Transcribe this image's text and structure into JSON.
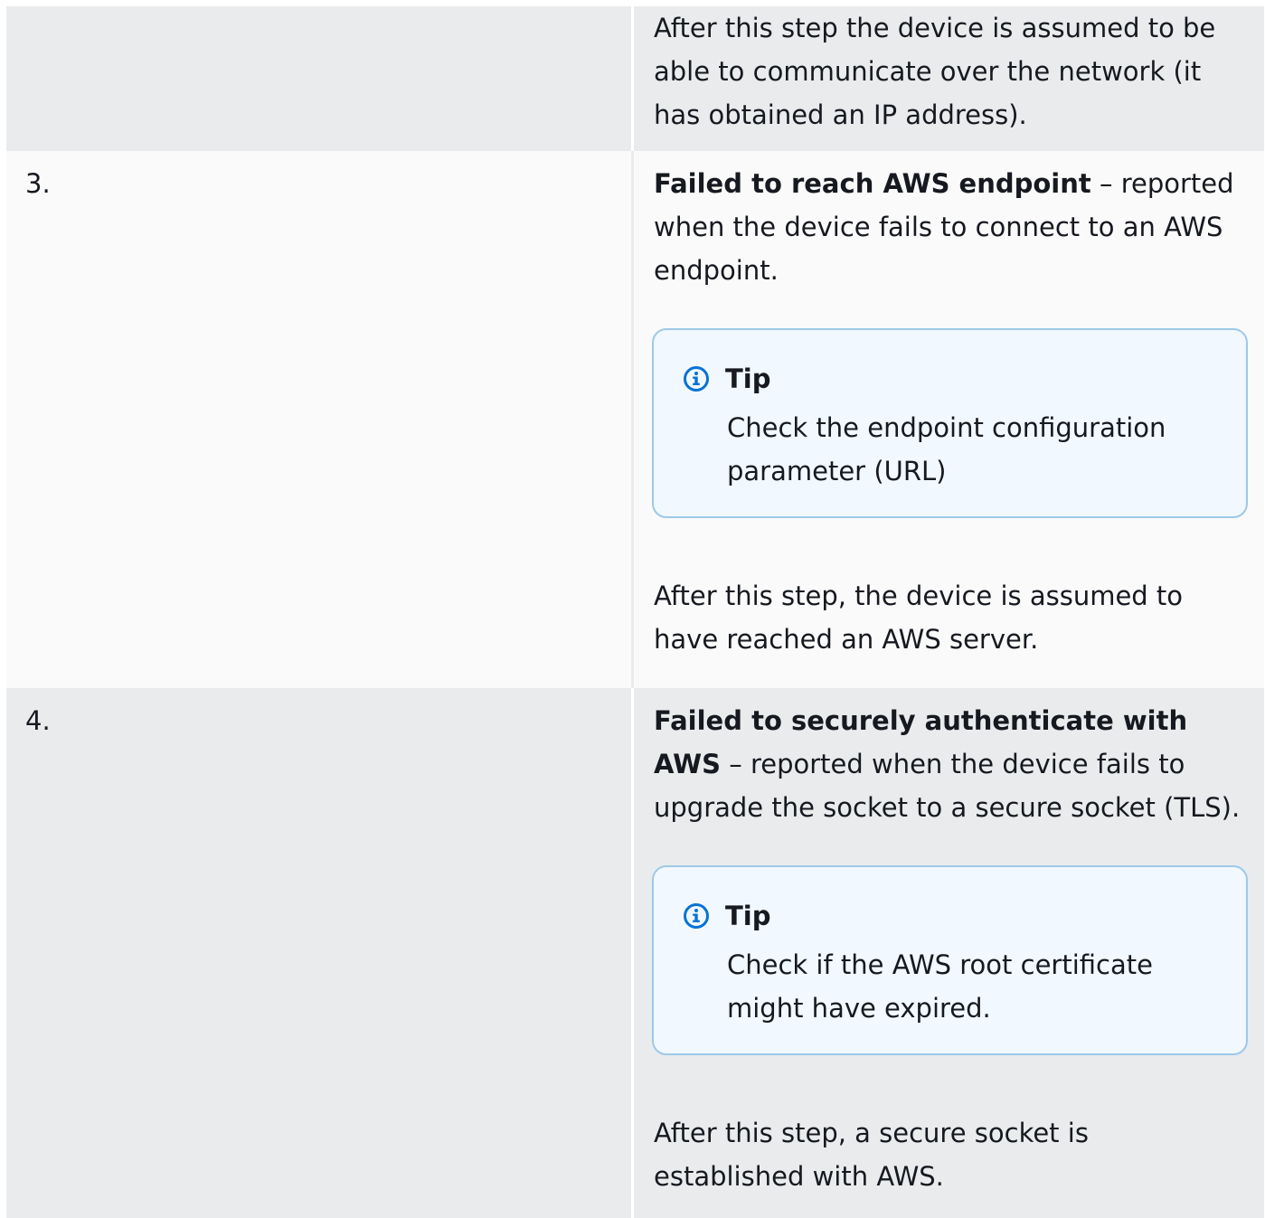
{
  "colors": {
    "row_gray": "#e9ebed",
    "row_white": "#fafafa",
    "tip_background": "#f1f8ff",
    "tip_border": "#9ec9e8",
    "icon_blue": "#0972d3"
  },
  "rows": [
    {
      "number": "",
      "after_text": "After this step the device is assumed to be able to communicate over the network (it has obtained an IP address)."
    },
    {
      "number": "3.",
      "title": "Failed to reach AWS endpoint",
      "description": " – reported when the device fails to connect to an AWS endpoint.",
      "tip_label": "Tip",
      "tip_icon": "info-icon",
      "tip_text": "Check the endpoint configuration parameter (URL)",
      "after_text": "After this step, the device is assumed to have reached an AWS server."
    },
    {
      "number": "4.",
      "title": "Failed to securely authenticate with AWS",
      "description": " – reported when the device fails to upgrade the socket to a secure socket (TLS).",
      "tip_label": "Tip",
      "tip_icon": "info-icon",
      "tip_text": "Check if the AWS root certificate might have expired.",
      "after_text": "After this step, a secure socket is established with AWS."
    }
  ]
}
